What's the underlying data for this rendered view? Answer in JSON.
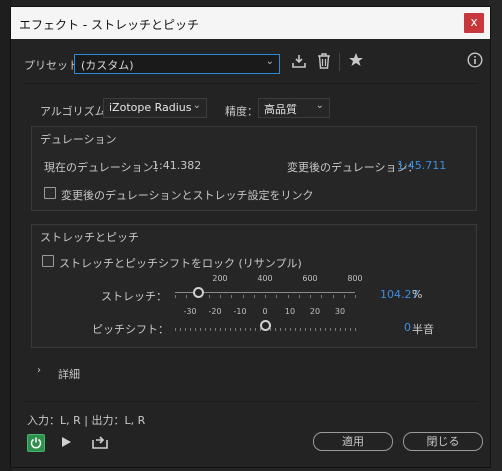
{
  "window": {
    "title": "エフェクト - ストレッチとピッチ",
    "close_label": "x"
  },
  "preset": {
    "label": "プリセット：",
    "value": "(カスタム)"
  },
  "icons": {
    "save": "save-preset-icon",
    "delete": "trash-icon",
    "favorite": "star-icon",
    "info": "info-icon"
  },
  "algorithm": {
    "label": "アルゴリズム：",
    "value": "iZotope Radius",
    "precision_label": "精度：",
    "precision_value": "高品質"
  },
  "duration": {
    "group_title": "デュレーション",
    "current_label": "現在のデュレーション：",
    "current_value": "1:41.382",
    "new_label": "変更後のデュレーション：",
    "new_value": "1:45.711",
    "link_label": "変更後のデュレーションとストレッチ設定をリンク",
    "link_checked": false
  },
  "stretch_pitch": {
    "group_title": "ストレッチとピッチ",
    "lock_label": "ストレッチとピッチシフトをロック (リサンプル)",
    "lock_checked": false,
    "stretch": {
      "label": "ストレッチ：",
      "value": "104.27",
      "unit": "%",
      "tick_labels": [
        "200",
        "400",
        "600",
        "800"
      ],
      "min": 0,
      "max": 800,
      "current": 104.27
    },
    "pitch": {
      "label": "ピッチシフト：",
      "value": "0",
      "unit": "半音",
      "tick_labels": [
        "-30",
        "-20",
        "-10",
        "0",
        "10",
        "20",
        "30"
      ],
      "min": -36,
      "max": 36,
      "current": 0
    }
  },
  "details": {
    "label": "詳細"
  },
  "io": {
    "label": "入力：L, R | 出力：L, R"
  },
  "buttons": {
    "apply": "適用",
    "close": "閉じる"
  },
  "colors": {
    "accent": "#3b8fe0",
    "power": "#2f8f4e",
    "close_button": "#c8373c"
  }
}
